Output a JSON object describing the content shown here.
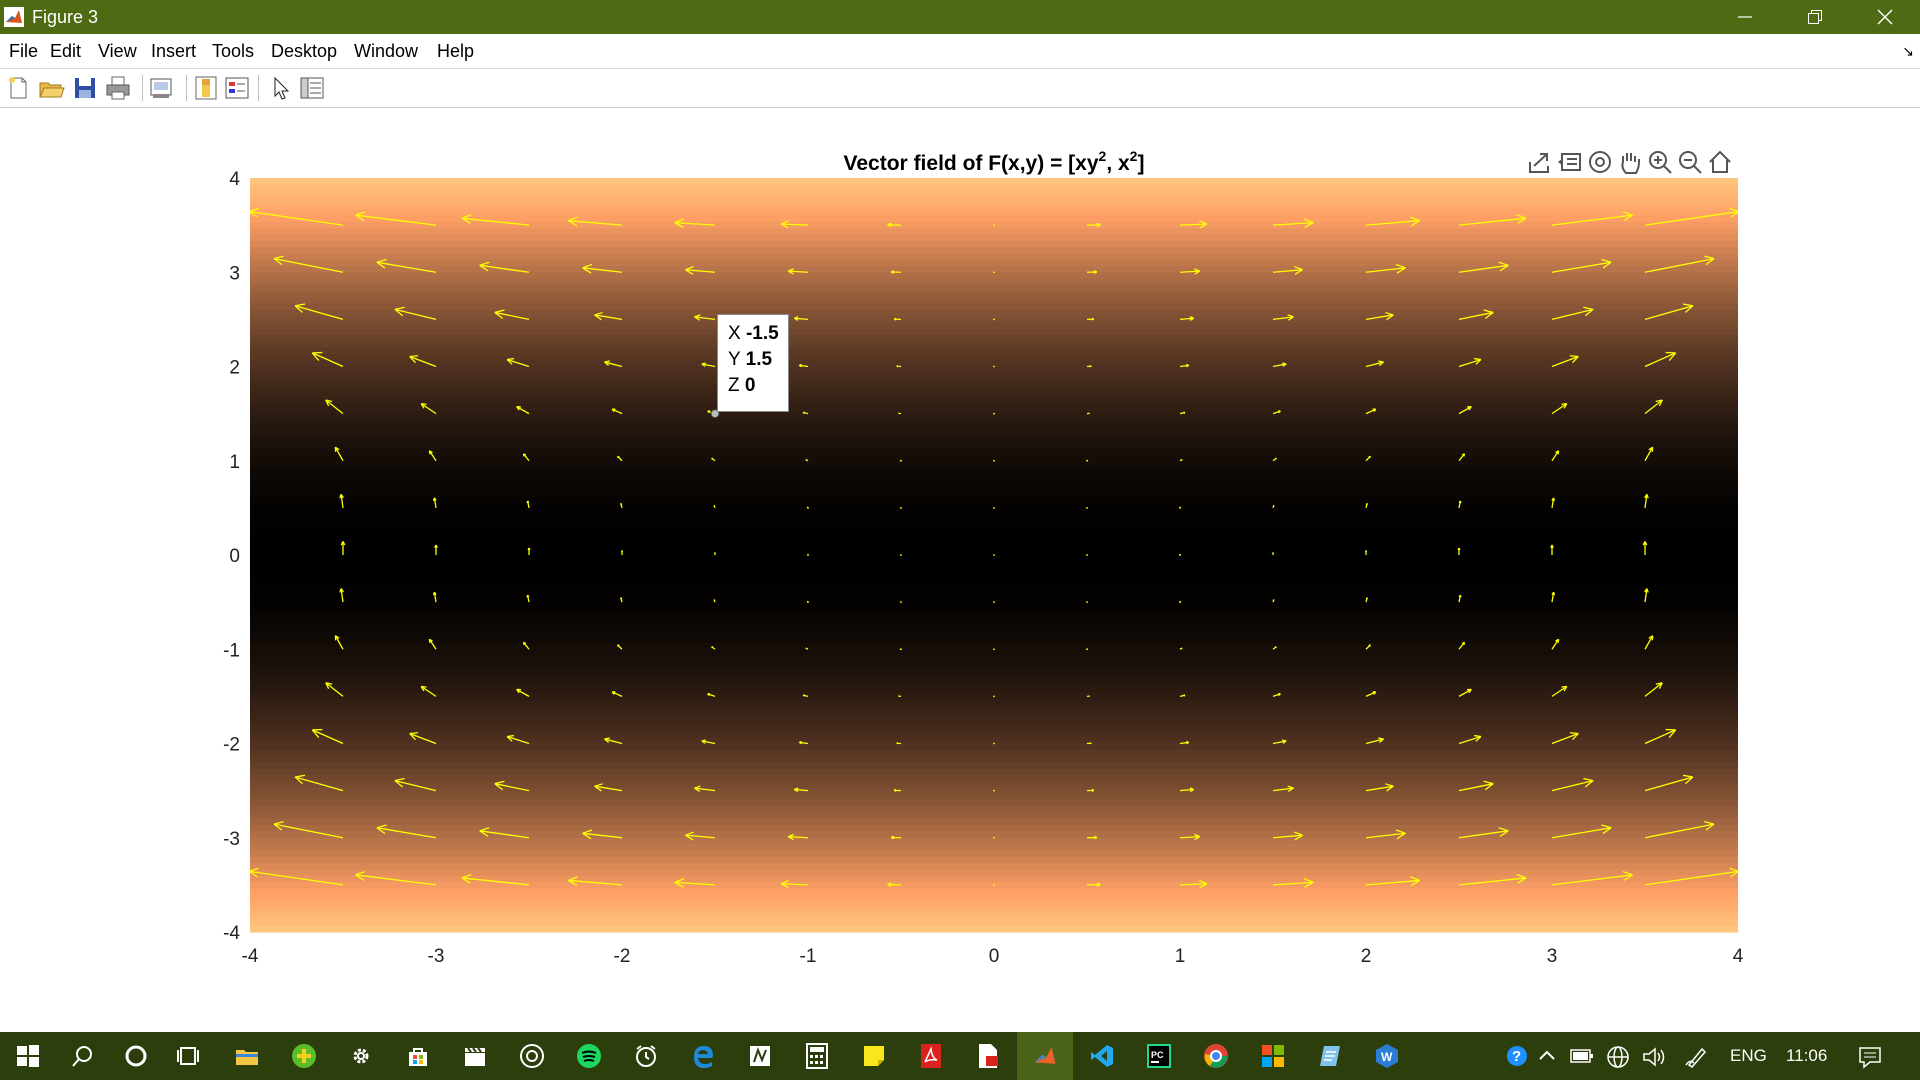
{
  "window": {
    "title": "Figure 3",
    "minimize_icon": "minimize-icon",
    "restore_icon": "restore-icon",
    "close_icon": "close-icon",
    "titlebar_color": "#4e6a12"
  },
  "menu": {
    "items": [
      "File",
      "Edit",
      "View",
      "Insert",
      "Tools",
      "Desktop",
      "Window",
      "Help"
    ],
    "dock_symbol": "↘"
  },
  "toolbar": {
    "icons": [
      "new-figure-icon",
      "open-file-icon",
      "save-icon",
      "print-icon",
      "link-plot-icon",
      "insert-colorbar-icon",
      "insert-legend-icon",
      "edit-plot-icon",
      "property-inspector-icon"
    ]
  },
  "axes_toolbar": {
    "icons": [
      "export-icon",
      "brush-icon",
      "rotate-icon",
      "pan-icon",
      "zoom-in-icon",
      "zoom-out-icon",
      "home-icon"
    ]
  },
  "chart_data": {
    "type": "quiver",
    "title_parts": [
      "Vector field of F(x,y) = [xy",
      "2",
      ", x",
      "2",
      "]"
    ],
    "xlabel": "",
    "ylabel": "",
    "xlim": [
      -4,
      4
    ],
    "ylim": [
      -4,
      4
    ],
    "xticks": [
      -4,
      -3,
      -2,
      -1,
      0,
      1,
      2,
      3,
      4
    ],
    "yticks": [
      4,
      3,
      2,
      1,
      0,
      -1,
      -2,
      -3,
      -4
    ],
    "x_grid": [
      -3.5,
      -3,
      -2.5,
      -2,
      -1.5,
      -1,
      -0.5,
      0,
      0.5,
      1,
      1.5,
      2,
      2.5,
      3,
      3.5
    ],
    "y_grid": [
      3.5,
      3,
      2.5,
      2,
      1.5,
      1,
      0.5,
      0,
      -0.5,
      -1,
      -1.5,
      -2,
      -2.5,
      -3,
      -3.5
    ],
    "u_formula": "x*y^2",
    "v_formula": "x^2",
    "background": "surface of z = y^2 shown with copper colormap",
    "colormap": "copper",
    "arrow_color": "#ffff00",
    "grid": false
  },
  "datatip": {
    "x_label": "X",
    "x_value": "-1.5",
    "y_label": "Y",
    "y_value": "1.5",
    "z_label": "Z",
    "z_value": "0",
    "anchor": [
      -1.5,
      1.5
    ]
  },
  "taskbar": {
    "icons": [
      "windows-start-icon",
      "search-icon",
      "cortana-icon",
      "task-view-icon",
      "file-explorer-icon",
      "app-plus-icon",
      "settings-icon",
      "store-icon",
      "video-editor-icon",
      "media-icon",
      "spotify-icon",
      "alarms-icon",
      "edge-icon",
      "onenote-icon",
      "calculator-icon",
      "sticky-notes-icon",
      "acrobat-icon",
      "pdf-tool-icon",
      "matlab-icon",
      "vscode-icon",
      "pycharm-icon",
      "chrome-icon",
      "office-icon",
      "notes-app-icon",
      "word-app-icon"
    ],
    "tray": {
      "help_icon": "help-icon",
      "chevron_icon": "chevron-up-icon",
      "battery_icon": "battery-icon",
      "network_icon": "network-icon",
      "volume_icon": "volume-icon",
      "pen_icon": "pen-icon",
      "language": "ENG",
      "time": "11:06",
      "notifications_icon": "notifications-icon"
    }
  }
}
